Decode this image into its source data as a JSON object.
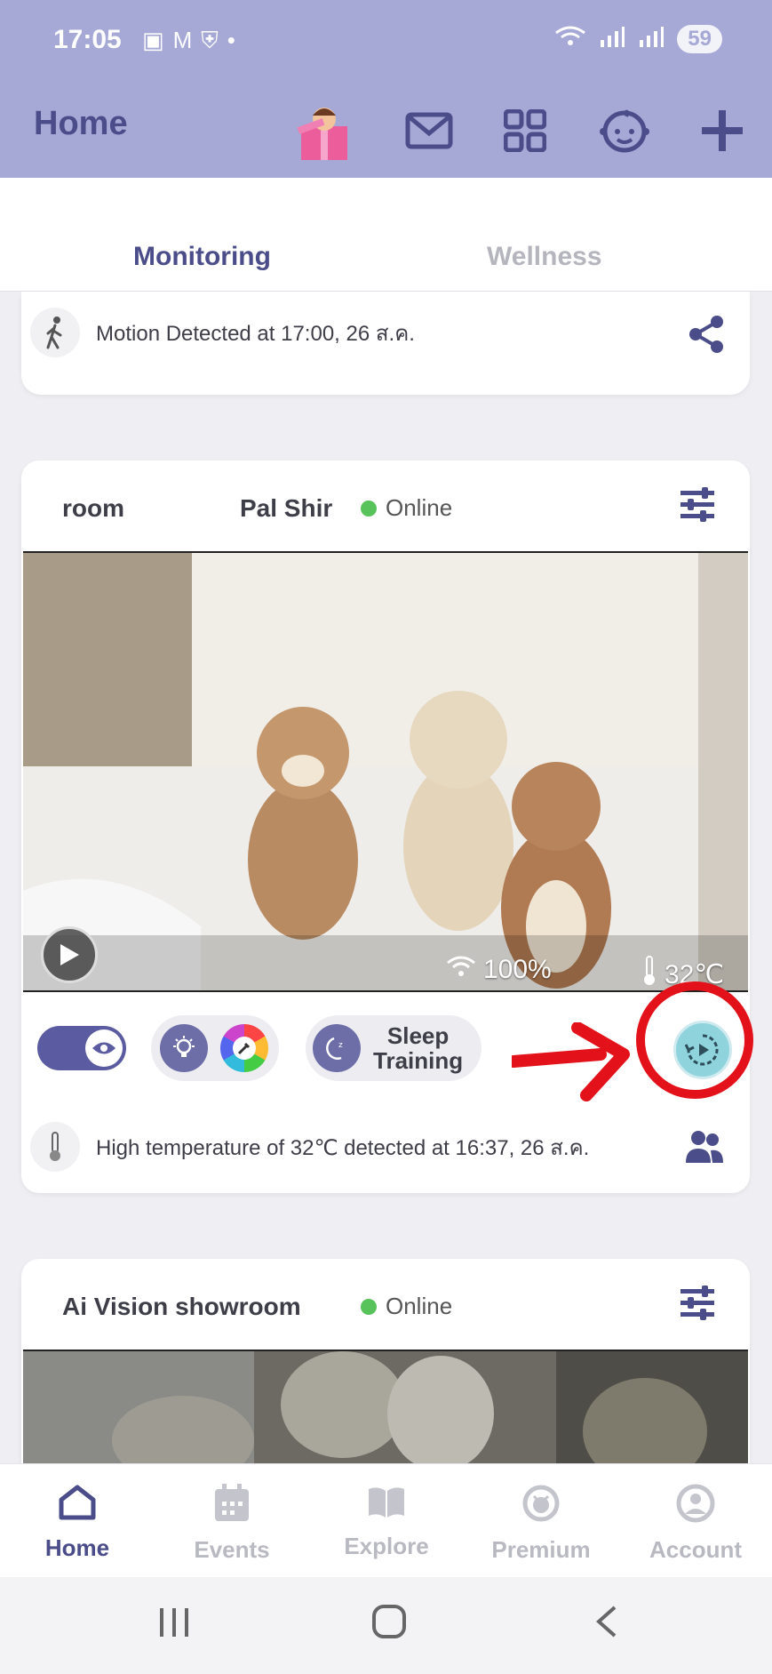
{
  "status_bar": {
    "time": "17:05",
    "battery": "59"
  },
  "app_bar": {
    "title": "Home"
  },
  "tabs": [
    {
      "label": "Monitoring"
    },
    {
      "label": "Wellness"
    }
  ],
  "motion_card": {
    "text": "Motion Detected at 17:00, 26 ส.ค."
  },
  "camera_card": {
    "name_left": "room",
    "name_right": "Pal Shir",
    "status": "Online",
    "wifi": "100%",
    "temperature": "32℃",
    "sleep_training_line1": "Sleep",
    "sleep_training_line2": "Training",
    "alert": "High temperature of 32℃ detected at 16:37, 26 ส.ค."
  },
  "camera_card_2": {
    "name": "Ai Vision showroom",
    "status": "Online"
  },
  "bottom_nav": [
    {
      "label": "Home"
    },
    {
      "label": "Events"
    },
    {
      "label": "Explore"
    },
    {
      "label": "Premium"
    },
    {
      "label": "Account"
    }
  ],
  "colors": {
    "header": "#a6a8d6",
    "accent": "#4b4c8a",
    "online": "#58c25b",
    "annotation": "#e3121a"
  }
}
